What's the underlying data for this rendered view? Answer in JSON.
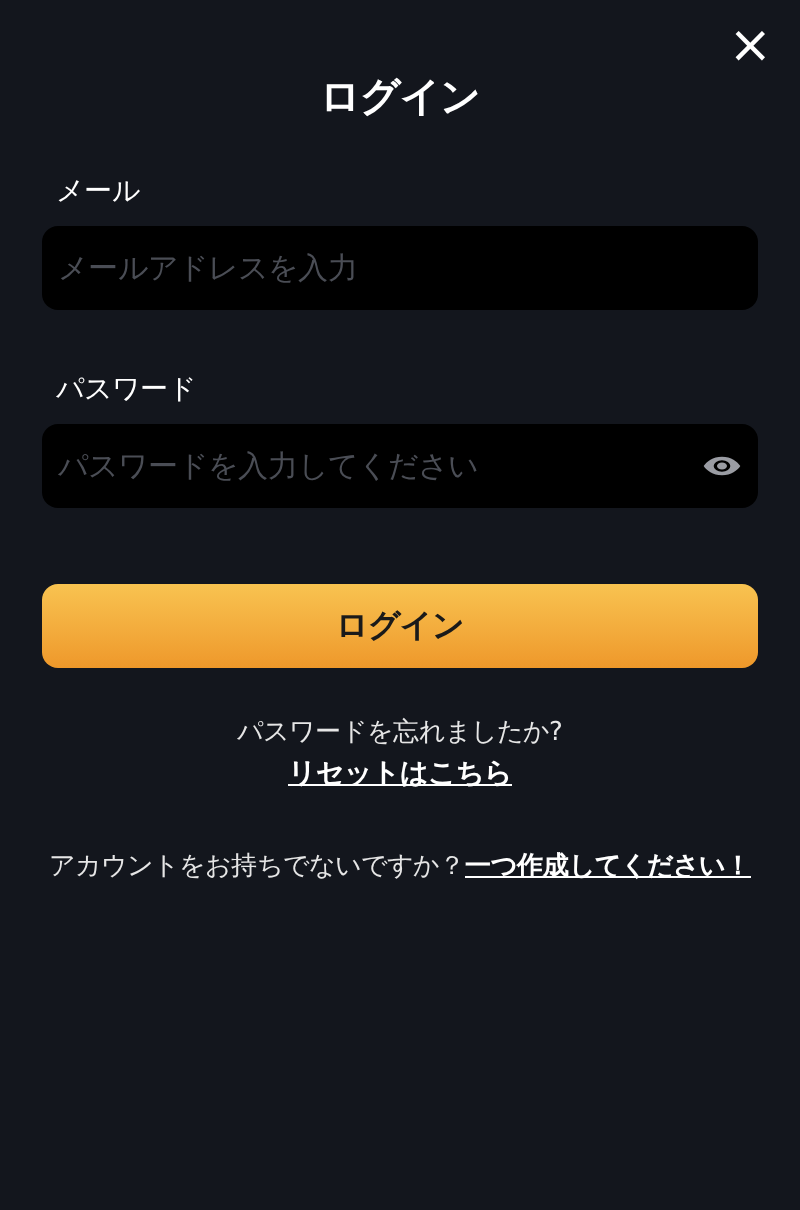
{
  "title": "ログイン",
  "close": "×",
  "fields": [
    {
      "label": "メール",
      "placeholder": "メールアドレスを入力",
      "kind": "text"
    },
    {
      "label": "パスワード",
      "placeholder": "パスワードを入力してください",
      "kind": "password"
    }
  ],
  "submit": "ログイン",
  "forgot": {
    "text": "パスワードを忘れましたか?",
    "link": "リセットはこちら"
  },
  "signup": {
    "text": "アカウントをお持ちでないですか？",
    "link": "一つ作成してください！"
  }
}
